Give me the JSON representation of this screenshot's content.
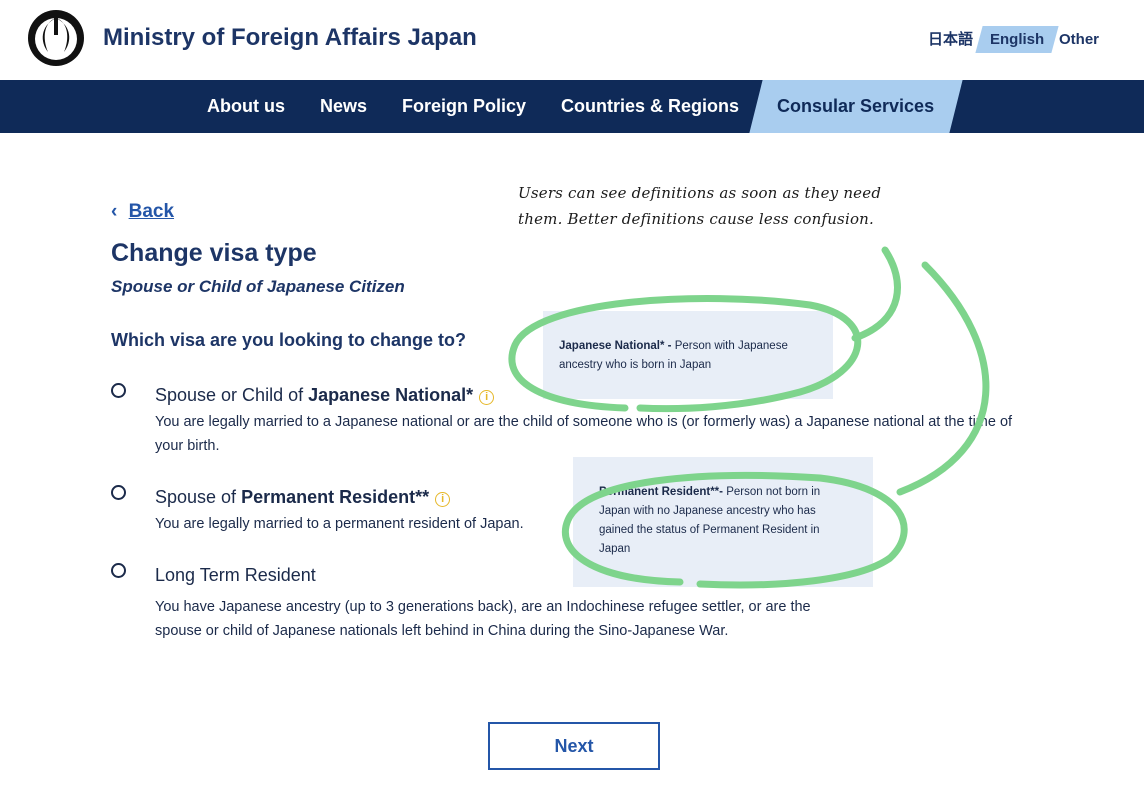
{
  "header": {
    "site_title": "Ministry of Foreign Affairs Japan",
    "languages": {
      "ja": "日本語",
      "en": "English",
      "other": "Other"
    }
  },
  "nav": {
    "items": [
      {
        "label": "About us"
      },
      {
        "label": "News"
      },
      {
        "label": "Foreign Policy"
      },
      {
        "label": "Countries & Regions"
      },
      {
        "label": "Consular Services",
        "active": true
      }
    ]
  },
  "page": {
    "back_label": "Back",
    "title": "Change visa type",
    "subtitle": "Spouse or Child of Japanese Citizen",
    "question": "Which visa are you looking to change to?"
  },
  "options": [
    {
      "title_prefix": "Spouse or Child of ",
      "title_bold": "Japanese National*",
      "has_info": true,
      "description": "You are legally married to a Japanese national or are the child of someone who is (or formerly was) a Japanese national at the time of your birth."
    },
    {
      "title_prefix": "Spouse of ",
      "title_bold": "Permanent Resident**",
      "has_info": true,
      "description": "You are legally married to a permanent resident of Japan."
    },
    {
      "title_prefix": "Long Term Resident",
      "title_bold": "",
      "has_info": false,
      "description": "You have Japanese ancestry (up to 3 generations back), are an Indochinese refugee settler, or are the spouse or child of Japanese nationals left behind in China during the Sino-Japanese War."
    }
  ],
  "definitions": [
    {
      "term": "Japanese National* - ",
      "text": "Person with Japanese ancestry who is born in Japan"
    },
    {
      "term": "Permanent Resident**- ",
      "text": "Person not born in Japan with no Japanese ancestry who has gained the status of Permanent Resident in Japan"
    }
  ],
  "annotation": {
    "line1": "Users can see definitions as soon as they need",
    "line2": "them. Better definitions cause less confusion."
  },
  "next_label": "Next",
  "icons": {
    "info": "i",
    "back": "‹"
  },
  "colors": {
    "nav_bg": "#0f2a58",
    "accent": "#a9cdef",
    "link": "#2456a8",
    "highlight": "#7ed48c",
    "info": "#e6b82a"
  }
}
